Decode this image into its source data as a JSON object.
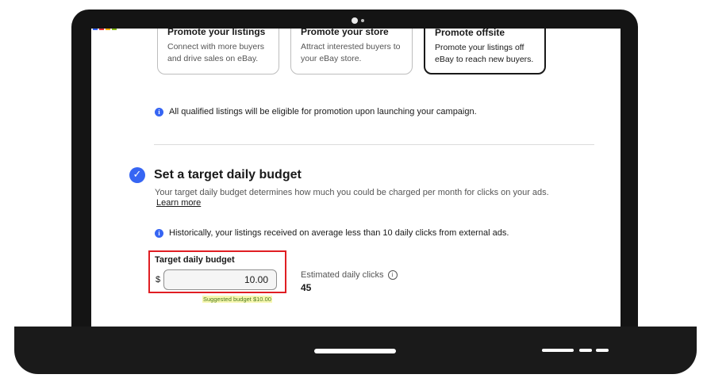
{
  "cards": [
    {
      "title": "Promote your listings",
      "desc_line1": "Connect with more buyers",
      "desc_line2": "and drive sales on eBay."
    },
    {
      "title": "Promote your store",
      "desc_line1": "Attract interested buyers to",
      "desc_line2": "your eBay store."
    },
    {
      "title": "Promote offsite",
      "desc_line1": "Promote your listings off",
      "desc_line2": "eBay to reach new buyers."
    }
  ],
  "notes": {
    "qualified": "All qualified listings will be eligible for promotion upon launching your campaign.",
    "historical": "Historically, your listings received on average less than 10 daily clicks from external ads."
  },
  "budget_section": {
    "title": "Set a target daily budget",
    "description": "Your target daily budget determines how much you could be charged per month for clicks on your ads.",
    "learn_more": "Learn more",
    "field_label": "Target daily budget",
    "currency": "$",
    "value": "10.00",
    "suggested": "Suggested budget $10.00",
    "estimated_label": "Estimated daily clicks",
    "estimated_value": "45"
  },
  "icons": {
    "info": "info-icon",
    "check": "check-circle-icon",
    "info_outline": "info-outline-icon"
  },
  "colors": {
    "accent": "#3665f3",
    "highlight_border": "#e01e23",
    "suggested_bg": "#f7f7b0"
  }
}
